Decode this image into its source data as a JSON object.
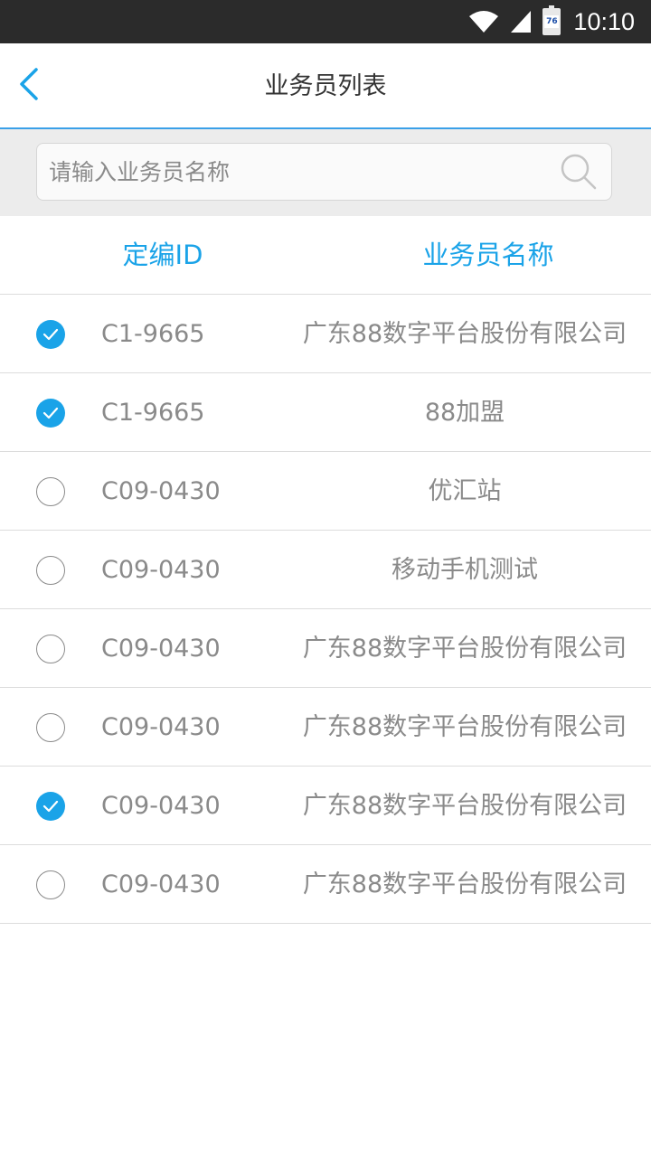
{
  "status_bar": {
    "time": "10:10",
    "battery_level": "76",
    "icons": [
      "wifi-icon",
      "signal-icon",
      "battery-icon"
    ]
  },
  "header": {
    "title": "业务员列表",
    "back_icon": "chevron-left-icon"
  },
  "search": {
    "placeholder": "请输入业务员名称",
    "value": "",
    "icon": "search-icon"
  },
  "columns": {
    "id_label": "定编ID",
    "name_label": "业务员名称"
  },
  "rows": [
    {
      "id": "C1-9665",
      "name": "广东88数字平台股份有限公司",
      "checked": true
    },
    {
      "id": "C1-9665",
      "name": "88加盟",
      "checked": true
    },
    {
      "id": "C09-0430",
      "name": "优汇站",
      "checked": false
    },
    {
      "id": "C09-0430",
      "name": "移动手机测试",
      "checked": false
    },
    {
      "id": "C09-0430",
      "name": "广东88数字平台股份有限公司",
      "checked": false
    },
    {
      "id": "C09-0430",
      "name": "广东88数字平台股份有限公司",
      "checked": false
    },
    {
      "id": "C09-0430",
      "name": "广东88数字平台股份有限公司",
      "checked": true
    },
    {
      "id": "C09-0430",
      "name": "广东88数字平台股份有限公司",
      "checked": false
    }
  ],
  "colors": {
    "accent": "#1aa3e8",
    "status_bar_bg": "#2b2b2b",
    "search_area_bg": "#ececec",
    "row_text": "#8a8a8a"
  }
}
